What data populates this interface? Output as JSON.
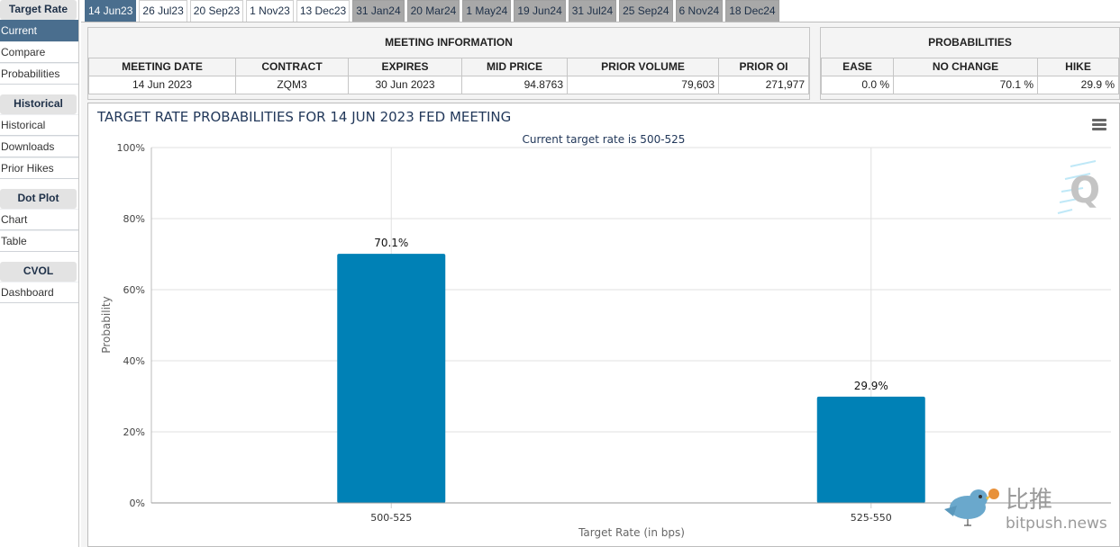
{
  "sidebar": {
    "sections": [
      {
        "title": "Target Rate",
        "items": [
          {
            "label": "Current",
            "active": true
          },
          {
            "label": "Compare"
          },
          {
            "label": "Probabilities"
          }
        ]
      },
      {
        "title": "Historical",
        "items": [
          {
            "label": "Historical"
          },
          {
            "label": "Downloads"
          },
          {
            "label": "Prior Hikes"
          }
        ]
      },
      {
        "title": "Dot Plot",
        "items": [
          {
            "label": "Chart"
          },
          {
            "label": "Table"
          }
        ]
      },
      {
        "title": "CVOL",
        "items": [
          {
            "label": "Dashboard"
          }
        ]
      }
    ]
  },
  "tabs": [
    {
      "label": "14 Jun23",
      "state": "active"
    },
    {
      "label": "26 Jul23",
      "state": "normal"
    },
    {
      "label": "20 Sep23",
      "state": "normal"
    },
    {
      "label": "1 Nov23",
      "state": "normal"
    },
    {
      "label": "13 Dec23",
      "state": "normal"
    },
    {
      "label": "31 Jan24",
      "state": "future"
    },
    {
      "label": "20 Mar24",
      "state": "future"
    },
    {
      "label": "1 May24",
      "state": "future"
    },
    {
      "label": "19 Jun24",
      "state": "future"
    },
    {
      "label": "31 Jul24",
      "state": "future"
    },
    {
      "label": "25 Sep24",
      "state": "future"
    },
    {
      "label": "6 Nov24",
      "state": "future"
    },
    {
      "label": "18 Dec24",
      "state": "future"
    }
  ],
  "meeting_info": {
    "title": "MEETING INFORMATION",
    "headers": [
      "MEETING DATE",
      "CONTRACT",
      "EXPIRES",
      "MID PRICE",
      "PRIOR VOLUME",
      "PRIOR OI"
    ],
    "values": [
      "14 Jun 2023",
      "ZQM3",
      "30 Jun 2023",
      "94.8763",
      "79,603",
      "271,977"
    ]
  },
  "probabilities": {
    "title": "PROBABILITIES",
    "headers": [
      "EASE",
      "NO CHANGE",
      "HIKE"
    ],
    "values": [
      "0.0 %",
      "70.1 %",
      "29.9 %"
    ]
  },
  "chart_data": {
    "type": "bar",
    "title": "TARGET RATE PROBABILITIES FOR 14 JUN 2023 FED MEETING",
    "subtitle": "Current target rate is 500-525",
    "xlabel": "Target Rate (in bps)",
    "ylabel": "Probability",
    "categories": [
      "500-525",
      "525-550"
    ],
    "values": [
      70.1,
      29.9
    ],
    "data_labels": [
      "70.1%",
      "29.9%"
    ],
    "ylim": [
      0,
      100
    ],
    "yticks": [
      0,
      20,
      40,
      60,
      80,
      100
    ],
    "ytick_labels": [
      "0%",
      "20%",
      "40%",
      "60%",
      "80%",
      "100%"
    ],
    "grid": true,
    "bar_color": "#0081b6"
  },
  "chart_menu_icon": "hamburger-menu-icon",
  "watermark": {
    "cn": "比推",
    "en": "bitpush.news"
  },
  "colors": {
    "accent": "#4a6e8e",
    "bar": "#0081b6",
    "title": "#22385a"
  }
}
